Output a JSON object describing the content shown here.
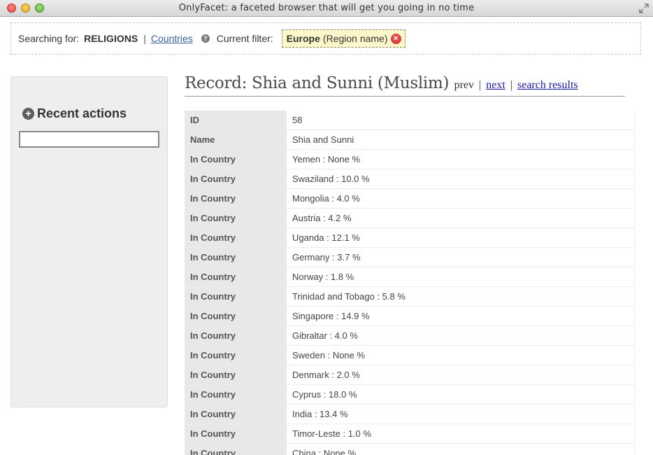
{
  "window": {
    "title": "OnlyFacet: a faceted browser that will get you going in no time"
  },
  "searchbar": {
    "searching_label": "Searching for:",
    "topic": "RELIGIONS",
    "separator": "|",
    "alt_link": "Countries",
    "help_icon": "?",
    "filter_label": "Current filter:",
    "filter": {
      "value": "Europe",
      "field": "(Region name)",
      "remove_icon": "×"
    }
  },
  "sidebar": {
    "plus_icon": "+",
    "heading": "Recent actions",
    "input_value": ""
  },
  "record": {
    "title": "Record: Shia and Sunni (Muslim)",
    "prev": "prev",
    "pipe": "|",
    "next": "next",
    "search_results": "search results",
    "rows": [
      {
        "key": "ID",
        "value": "58"
      },
      {
        "key": "Name",
        "value": "Shia and Sunni"
      },
      {
        "key": "In Country",
        "value": "Yemen : None %"
      },
      {
        "key": "In Country",
        "value": "Swaziland : 10.0 %"
      },
      {
        "key": "In Country",
        "value": "Mongolia : 4.0 %"
      },
      {
        "key": "In Country",
        "value": "Austria : 4.2 %"
      },
      {
        "key": "In Country",
        "value": "Uganda : 12.1 %"
      },
      {
        "key": "In Country",
        "value": "Germany : 3.7 %"
      },
      {
        "key": "In Country",
        "value": "Norway : 1.8 %"
      },
      {
        "key": "In Country",
        "value": "Trinidad and Tobago : 5.8 %"
      },
      {
        "key": "In Country",
        "value": "Singapore : 14.9 %"
      },
      {
        "key": "In Country",
        "value": "Gibraltar : 4.0 %"
      },
      {
        "key": "In Country",
        "value": "Sweden : None %"
      },
      {
        "key": "In Country",
        "value": "Denmark : 2.0 %"
      },
      {
        "key": "In Country",
        "value": "Cyprus : 18.0 %"
      },
      {
        "key": "In Country",
        "value": "India : 13.4 %"
      },
      {
        "key": "In Country",
        "value": "Timor-Leste : 1.0 %"
      },
      {
        "key": "In Country",
        "value": "China : None %"
      }
    ]
  }
}
